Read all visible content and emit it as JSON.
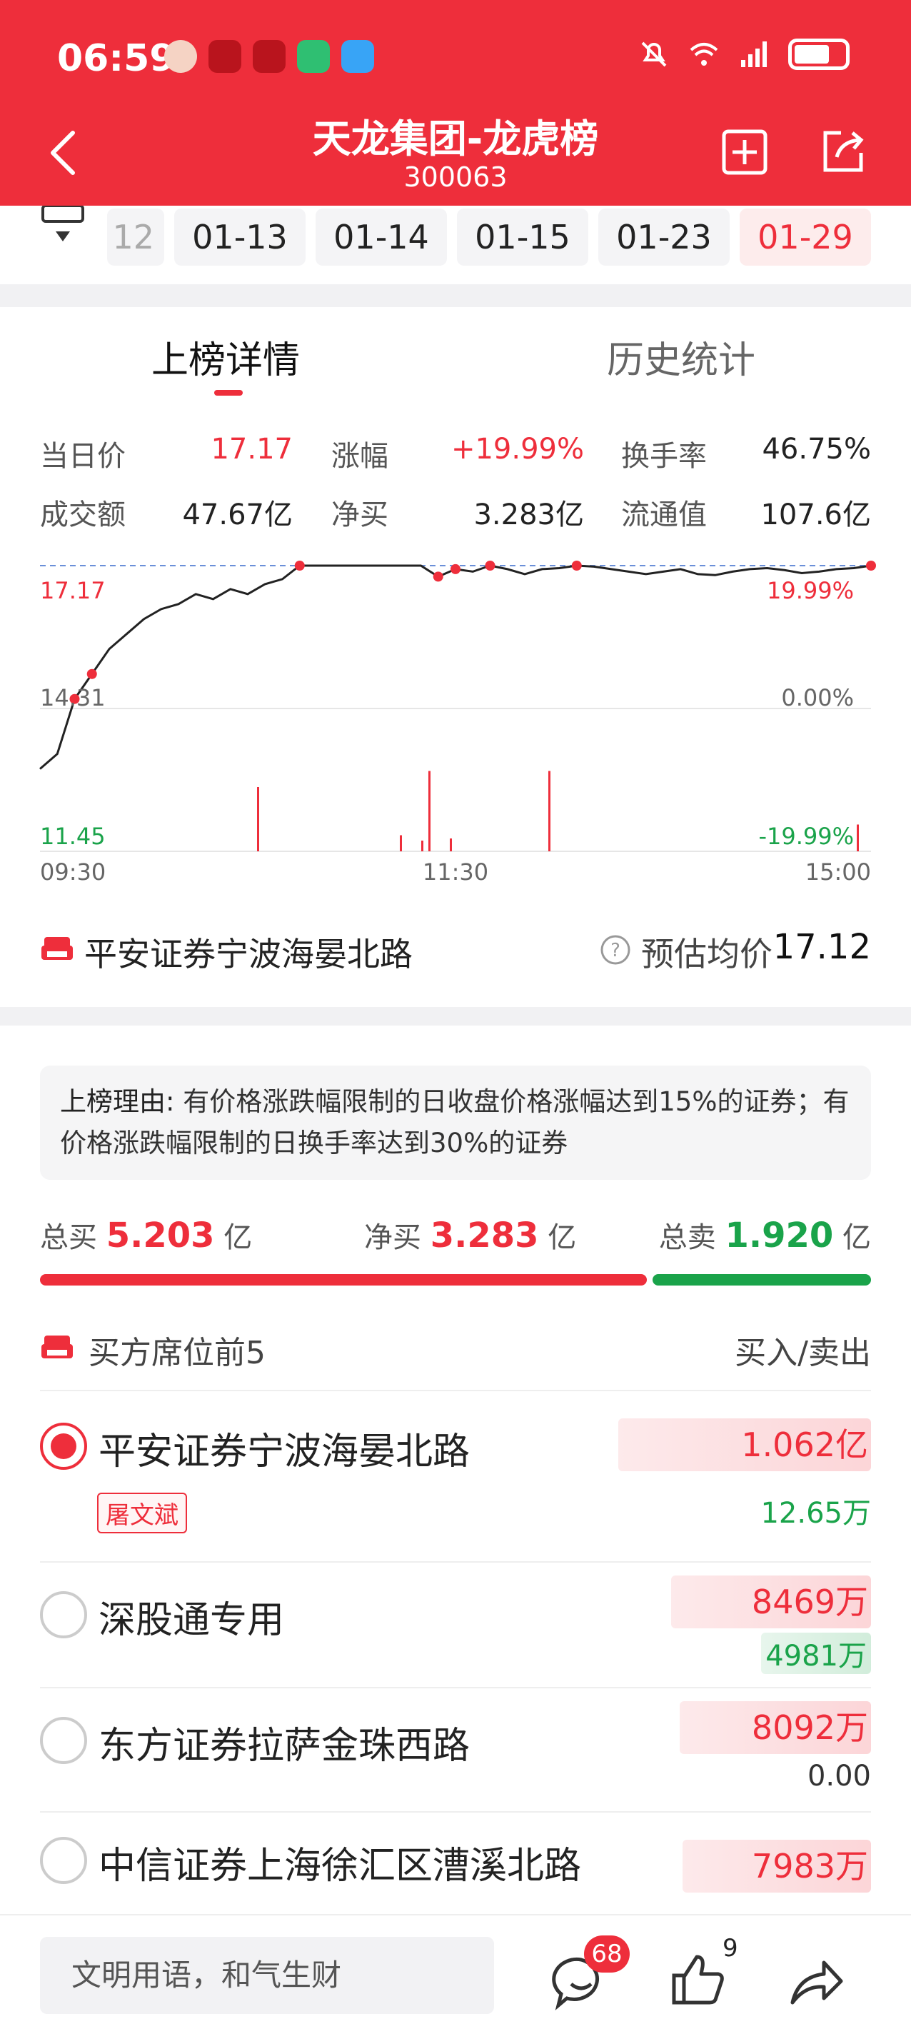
{
  "status_bar": {
    "time": "06:59"
  },
  "header": {
    "title": "天龙集团-龙虎榜",
    "code": "300063"
  },
  "dates": {
    "partial": "12",
    "items": [
      "01-13",
      "01-14",
      "01-15",
      "01-23",
      "01-29"
    ],
    "active": "01-29"
  },
  "tabs": {
    "detail": "上榜详情",
    "history": "历史统计"
  },
  "stats": {
    "price_label": "当日价",
    "price": "17.17",
    "change_label": "涨幅",
    "change": "+19.99%",
    "turnover_label": "换手率",
    "turnover": "46.75%",
    "amount_label": "成交额",
    "amount": "47.67亿",
    "net_label": "净买",
    "net": "3.283亿",
    "float_label": "流通值",
    "float": "107.6亿"
  },
  "chart_data": {
    "type": "line",
    "y_left_ticks": [
      "17.17",
      "14.31",
      "11.45"
    ],
    "y_right_ticks": [
      "19.99%",
      "0.00%",
      "-19.99%"
    ],
    "x_ticks": [
      "09:30",
      "11:30",
      "15:00"
    ],
    "ylim": [
      11.45,
      17.17
    ],
    "series": [
      {
        "values": [
          13.1,
          13.4,
          14.5,
          15.0,
          15.5,
          15.8,
          16.1,
          16.3,
          16.4,
          16.6,
          16.5,
          16.7,
          16.6,
          16.8,
          16.9,
          17.17,
          17.17,
          17.17,
          17.17,
          17.17,
          17.17,
          17.17,
          17.17,
          16.95,
          17.1,
          17.05,
          17.17,
          17.1,
          17.0,
          17.1,
          17.12,
          17.17,
          17.15,
          17.1,
          17.05,
          17.0,
          17.05,
          17.1,
          17.0,
          16.98,
          17.05,
          17.1,
          17.12,
          17.08,
          17.02,
          17.05,
          17.1,
          17.12,
          17.17
        ]
      }
    ],
    "volume_spikes": [
      0.6,
      0.15,
      0.75,
      0.1,
      0.12,
      0.75,
      0.25
    ]
  },
  "broker": {
    "name": "平安证券宁波海晏北路",
    "avg_label": "预估均价",
    "avg_value": "17.12"
  },
  "reason": {
    "label": "上榜理由:",
    "text": "有价格涨跌幅限制的日收盘价格涨幅达到15%的证券；有价格涨跌幅限制的日换手率达到30%的证券"
  },
  "totals": {
    "buy_label": "总买",
    "buy_value": "5.203",
    "buy_unit": "亿",
    "net_label": "净买",
    "net_value": "3.283",
    "net_unit": "亿",
    "sell_label": "总卖",
    "sell_value": "1.920",
    "sell_unit": "亿"
  },
  "seats": {
    "title": "买方席位前5",
    "header_right": "买入/卖出",
    "rows": [
      {
        "name": "平安证券宁波海晏北路",
        "tag": "屠文斌",
        "buy": "1.062亿",
        "sell": "12.65万"
      },
      {
        "name": "深股通专用",
        "buy": "8469万",
        "sell": "4981万"
      },
      {
        "name": "东方证券拉萨金珠西路",
        "buy": "8092万",
        "sell": "0.00"
      },
      {
        "name": "中信证券上海徐汇区漕溪北路",
        "buy": "7983万",
        "sell": ""
      }
    ]
  },
  "bottom": {
    "placeholder": "文明用语，和气生财",
    "comment_count": "68",
    "like_count": "9"
  },
  "colors": {
    "brand_red": "#ee2e3b",
    "green": "#1aa34a"
  }
}
